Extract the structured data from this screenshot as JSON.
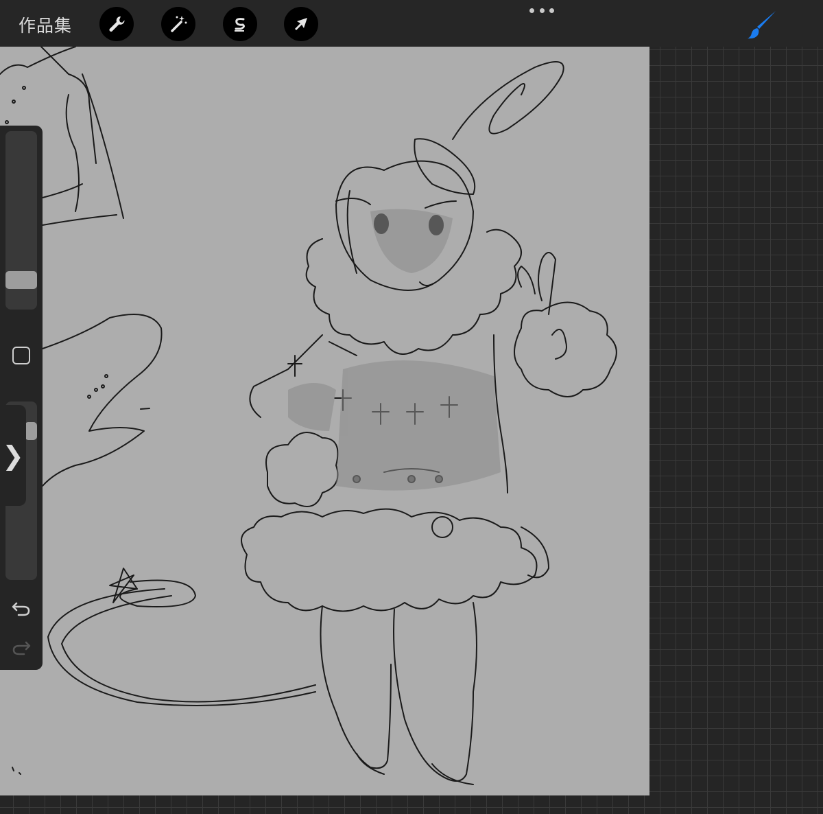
{
  "topbar": {
    "gallery_label": "作品集",
    "tools": [
      {
        "name": "actions",
        "icon": "wrench-icon"
      },
      {
        "name": "adjustments",
        "icon": "magic-wand-icon"
      },
      {
        "name": "selection",
        "icon": "selection-s-icon"
      },
      {
        "name": "transform",
        "icon": "arrow-cursor-icon"
      }
    ],
    "more_icon": "more-dots-icon",
    "active_tool_icon": "brush-icon",
    "accent_color": "#1a7cf0"
  },
  "sidebar": {
    "brush_size_level": 0.78,
    "opacity_level": 0.15,
    "modify_icon": "square-modify-icon",
    "undo_icon": "undo-icon",
    "redo_icon": "redo-icon",
    "handle_glyph": "❯"
  },
  "canvas": {
    "background_color": "#adadad",
    "content": "sketch-artwork"
  }
}
